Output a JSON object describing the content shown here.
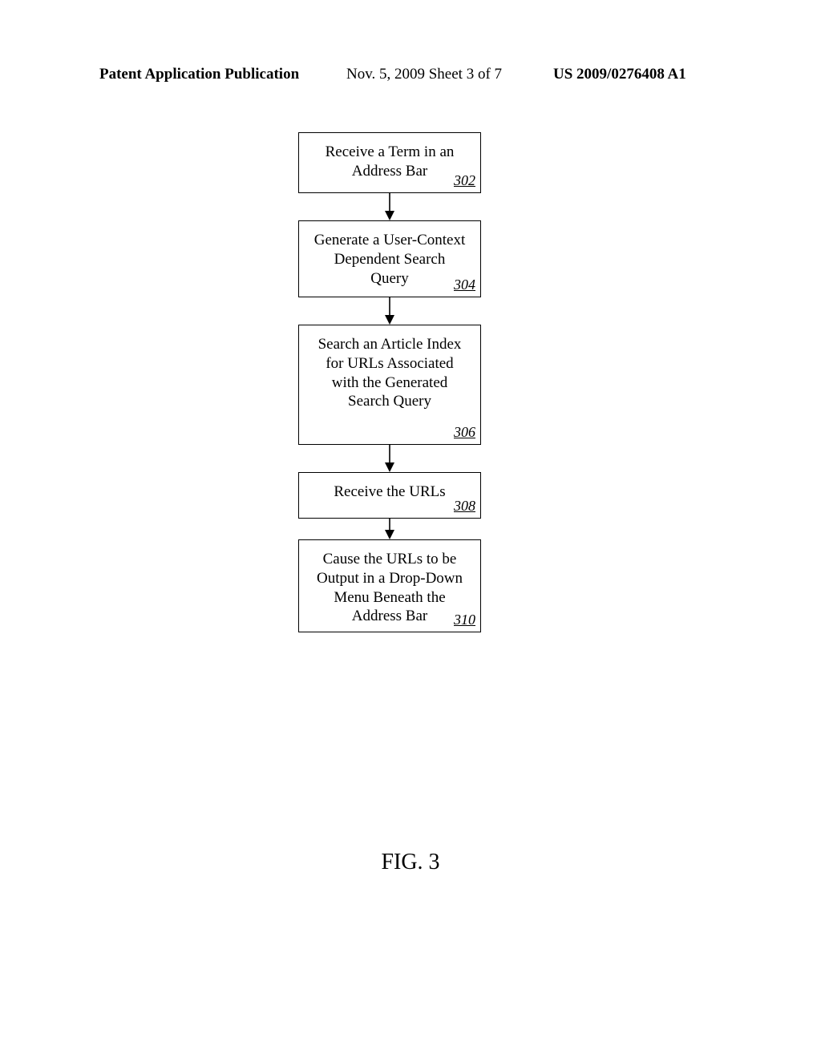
{
  "header": {
    "left": "Patent Application Publication",
    "center": "Nov. 5, 2009  Sheet 3 of 7",
    "right": "US 2009/0276408 A1"
  },
  "flow": {
    "steps": [
      {
        "text": "Receive a Term in an Address Bar",
        "ref": "302"
      },
      {
        "text": "Generate a User-Context Dependent Search Query",
        "ref": "304"
      },
      {
        "text": "Search an Article Index for URLs Associated with the Generated Search Query",
        "ref": "306"
      },
      {
        "text": "Receive the URLs",
        "ref": "308"
      },
      {
        "text": "Cause the URLs to be Output in a Drop-Down Menu Beneath the Address Bar",
        "ref": "310"
      }
    ]
  },
  "figure_label": "FIG. 3"
}
